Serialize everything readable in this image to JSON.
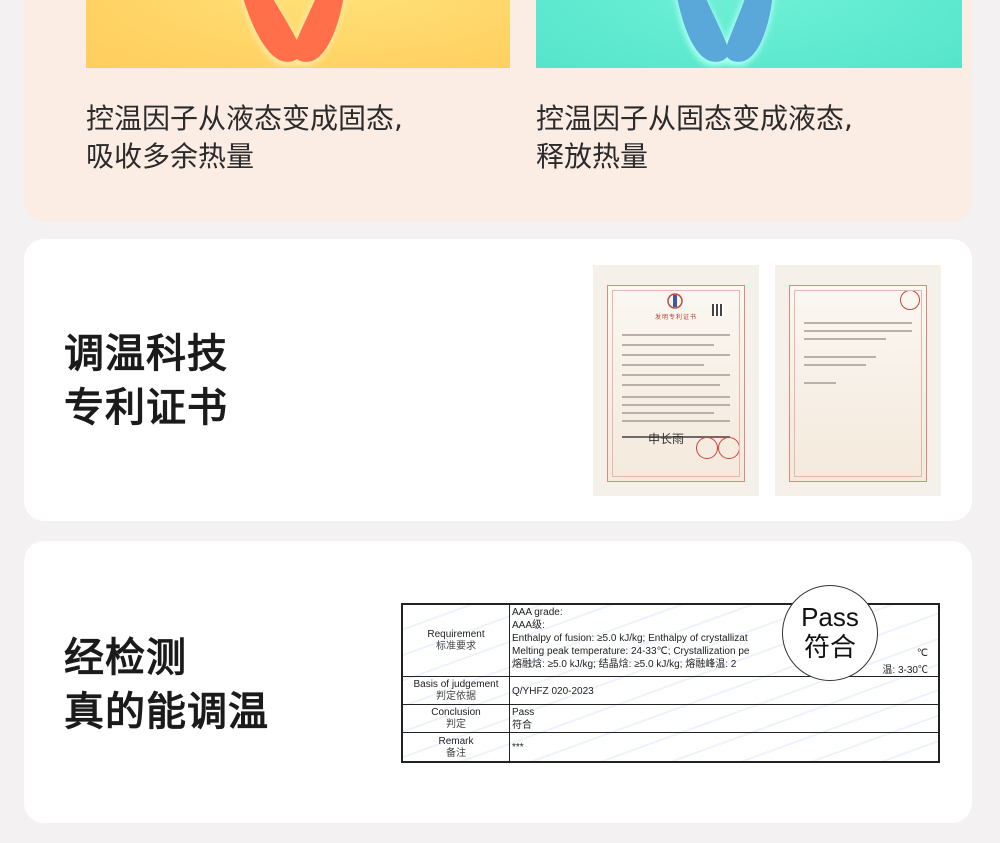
{
  "section_phase": {
    "left_caption_line1": "控温因子从液态变成固态,",
    "left_caption_line2": "吸收多余热量",
    "right_caption_line1": "控温因子从固态变成液态,",
    "right_caption_line2": "释放热量",
    "colors": {
      "warm_tile": "#ffd466",
      "warm_foot": "#ff6f4a",
      "cool_tile": "#5fead0",
      "cool_foot": "#5aa7d9"
    }
  },
  "section_patent": {
    "title_line1": "调温科技",
    "title_line2": "专利证书",
    "cert1_head": "发明专利证书",
    "cert1_signature": "申长雨"
  },
  "section_test": {
    "title_line1": "经检测",
    "title_line2": "真的能调温",
    "stamp_en": "Pass",
    "stamp_zh": "符合",
    "table": {
      "requirement_label_en": "Requirement",
      "requirement_label_zh": "标准要求",
      "requirement_lines": [
        "AAA grade:",
        "AAA级:",
        "Enthalpy of fusion: ≥5.0 kJ/kg; Enthalpy of crystallizat",
        "Melting peak temperature: 24-33℃; Crystallization pe",
        "熔融焓: ≥5.0 kJ/kg; 结晶焓: ≥5.0 kJ/kg; 熔融峰温: 2"
      ],
      "requirement_tail_1": "℃",
      "requirement_tail_2": "温: 3-30℃",
      "basis_label_en": "Basis of judgement",
      "basis_label_zh": "判定依据",
      "basis_value": "Q/YHFZ 020-2023",
      "conclusion_label_en": "Conclusion",
      "conclusion_label_zh": "判定",
      "conclusion_value_en": "Pass",
      "conclusion_value_zh": "符合",
      "remark_label_en": "Remark",
      "remark_label_zh": "备注",
      "remark_value": "***"
    }
  }
}
